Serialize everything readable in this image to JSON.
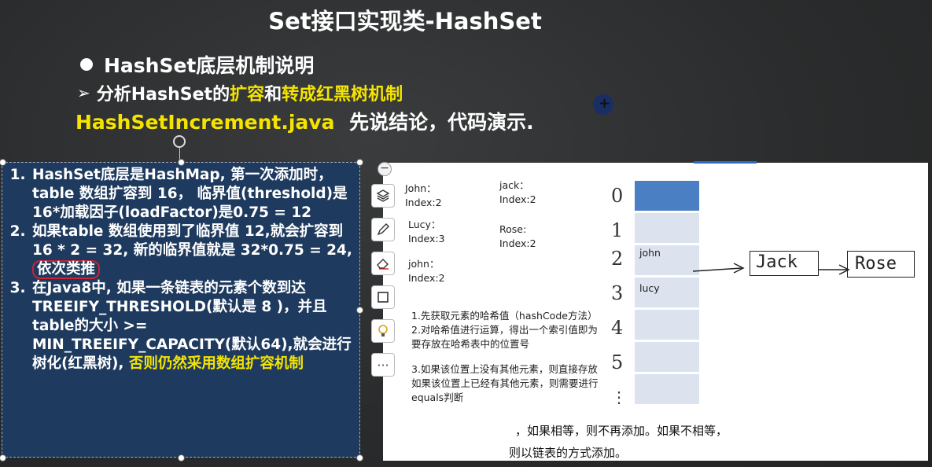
{
  "title": "Set接口实现类-HashSet",
  "bullet": "HashSet底层机制说明",
  "subtitle": {
    "prefix": "分析HashSet的",
    "hl1": "扩容",
    "mid": "和",
    "hl2": "转成红黑树机制"
  },
  "file_line": {
    "file": "HashSetIncrement.java",
    "note": "先说结论，代码演示."
  },
  "panel": {
    "item1": "HashSet底层是HashMap, 第一次添加时，table 数组扩容到 16， 临界值(threshold)是 16*加载因子(loadFactor)是0.75 = 12",
    "item2_main": "如果table 数组使用到了临界值 12,就会扩容到 16 * 2 = 32, 新的临界值就是 32*0.75 = 24, ",
    "item2_circled": "依次类推",
    "item3_main": "在Java8中, 如果一条链表的元素个数到达 TREEIFY_THRESHOLD(默认是 8 )，并且table的大小 >= MIN_TREEIFY_CAPACITY(默认64),就会进行树化(红黑树), ",
    "item3_hl": "否则仍然采用数组扩容机制"
  },
  "toolbar": {
    "minus": "−",
    "more": "···"
  },
  "diagram": {
    "entries": [
      {
        "name": "John：",
        "index": "Index:2"
      },
      {
        "name": "Lucy：",
        "index": "Index:3"
      },
      {
        "name": "john：",
        "index": "Index:2"
      },
      {
        "name": "jack：",
        "index": "Index:2"
      },
      {
        "name": "Rose:",
        "index": "Index:2"
      }
    ],
    "indices": [
      "0",
      "1",
      "2",
      "3",
      "4",
      "5",
      "⋮"
    ],
    "cell_labels": {
      "c2": "john",
      "c3": "lucy"
    },
    "chain": [
      "Jack",
      "Rose"
    ],
    "steps": [
      "1.先获取元素的哈希值（hashCode方法）",
      "2.对哈希值进行运算，得出一个索引值即为要存放在哈希表中的位置号",
      "3.如果该位置上没有其他元素，则直接存放",
      "如果该位置上已经有其他元素，则需要进行equals判断"
    ],
    "bottom1": "，如果相等，则不再添加。如果不相等，",
    "bottom2": "则以链表的方式添加。"
  }
}
